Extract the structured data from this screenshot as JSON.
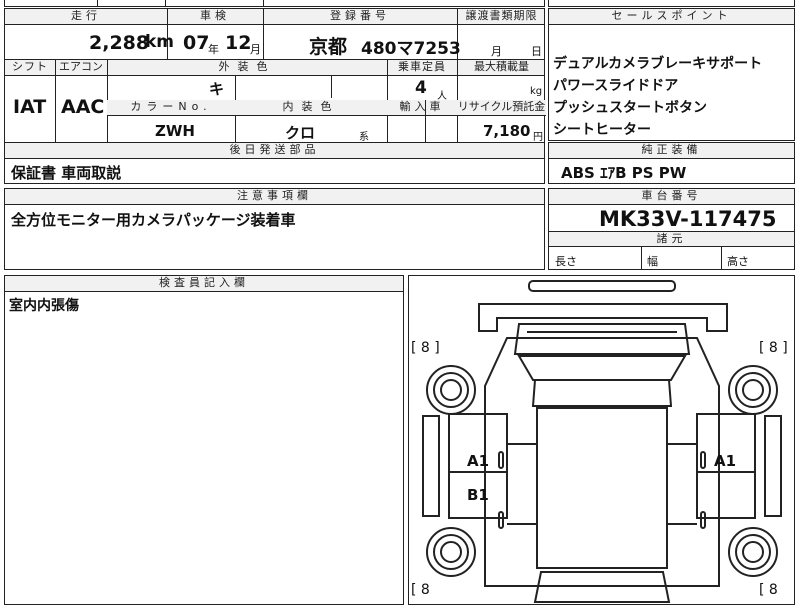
{
  "top": {
    "headers": {
      "mileage": "走行",
      "inspection": "車検",
      "registration": "登録番号",
      "transfer": "譲渡書類期限"
    },
    "mileage_value": "2,288",
    "mileage_unit": "km",
    "inspection_year": "07",
    "year_suffix": "年",
    "inspection_month": "12",
    "month_suffix": "月",
    "registration_area": "京都",
    "registration_number": "480マ7253",
    "transfer_month": "月",
    "transfer_day": "日"
  },
  "spec": {
    "headers": {
      "shift": "シフト",
      "aircon": "エアコン",
      "exterior_color": "外装色",
      "capacity": "乗車定員",
      "max_load": "最大積載量",
      "color_no": "カラーNo.",
      "interior_color": "内装色",
      "import": "輸入車",
      "recycle": "リサイクル預託金"
    },
    "shift_value": "IAT",
    "aircon_value": "AAC",
    "exterior_color_value": "キ",
    "capacity_value": "4",
    "capacity_unit": "人",
    "max_load_unit": "kg",
    "color_no_value": "ZWH",
    "interior_color_value": "クロ",
    "interior_suffix": "系",
    "recycle_value": "7,180",
    "recycle_unit": "円"
  },
  "later_parts": {
    "header": "後日発送部品",
    "value": "保証書 車両取説"
  },
  "notes": {
    "header": "注意事項欄",
    "value": "全方位モニター用カメラパッケージ装着車"
  },
  "sales_points": {
    "header": "セールスポイント",
    "items": [
      "デュアルカメラブレーキサポート",
      "パワースライドドア",
      "プッシュスタートボタン",
      "シートヒーター"
    ]
  },
  "equipment": {
    "header": "純正装備",
    "value": "ABS ｴｱB PS PW"
  },
  "chassis": {
    "header": "車台番号",
    "value": "MK33V-117475"
  },
  "dimensions": {
    "header": "諸元",
    "length": "長さ",
    "width": "幅",
    "height": "高さ"
  },
  "inspector": {
    "header": "検査員記入欄",
    "value": "室内内張傷"
  },
  "diagram": {
    "tread_tl": "[ 8 ]",
    "tread_tr": "[ 8 ]",
    "tread_bl": "[ 8",
    "tread_br": "[ 8",
    "mark_left_1": "A1",
    "mark_left_2": "B1",
    "mark_right_1": "A1"
  }
}
